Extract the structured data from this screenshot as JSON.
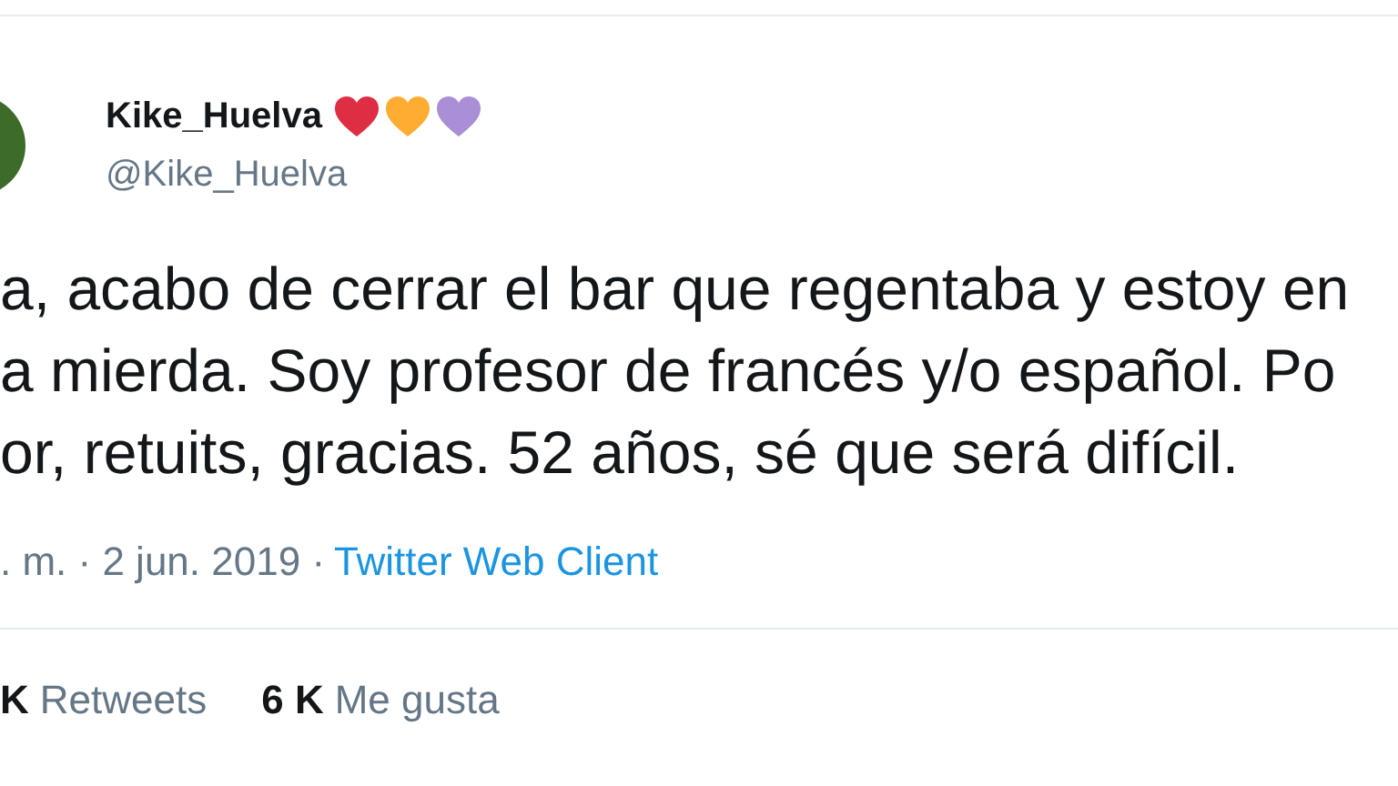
{
  "author": {
    "name": "Kike_Huelva",
    "handle": "@Kike_Huelva",
    "hearts": [
      {
        "color": "#dd2e44"
      },
      {
        "color": "#ffac33"
      },
      {
        "color": "#aa8ed6"
      }
    ]
  },
  "text_lines": [
    "a, acabo de cerrar el bar que regentaba y estoy en",
    "a mierda. Soy profesor de francés y/o español. Po",
    "or, retuits, gracias. 52 años, sé que será difícil."
  ],
  "meta": {
    "date": ". m. · 2 jun. 2019 · ",
    "source": "Twitter Web Client"
  },
  "stats": [
    {
      "count": "K",
      "label": "Retweets"
    },
    {
      "count": "6 K",
      "label": "Me gusta"
    }
  ]
}
